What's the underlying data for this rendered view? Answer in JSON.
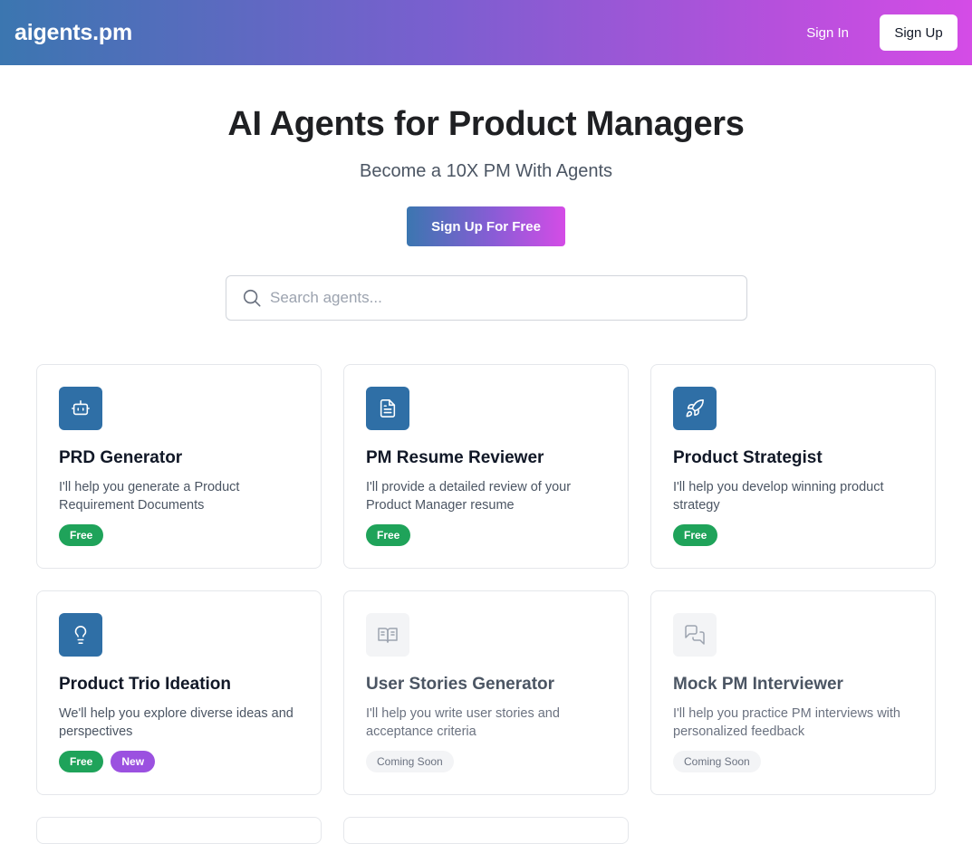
{
  "nav": {
    "logo": "aigents.pm",
    "sign_in": "Sign In",
    "sign_up": "Sign Up"
  },
  "hero": {
    "title": "AI Agents for Product Managers",
    "subtitle": "Become a 10X PM With Agents",
    "cta": "Sign Up For Free"
  },
  "search": {
    "placeholder": "Search agents...",
    "icon": "search-icon"
  },
  "colors": {
    "brand_gradient_start": "#3b76b0",
    "brand_gradient_end": "#d44ce6",
    "icon_bg_active": "#2f6fa6",
    "free_badge": "#1fa35a",
    "new_badge": "#9b51e0"
  },
  "cards": [
    {
      "title": "PRD Generator",
      "description": "I'll help you generate a Product Requirement Documents",
      "icon": "robot-icon",
      "tags": [
        "Free"
      ]
    },
    {
      "title": "PM Resume Reviewer",
      "description": "I'll provide a detailed review of your Product Manager resume",
      "icon": "document-icon",
      "tags": [
        "Free"
      ]
    },
    {
      "title": "Product Strategist",
      "description": "I'll help you develop winning product strategy",
      "icon": "rocket-icon",
      "tags": [
        "Free"
      ]
    },
    {
      "title": "Product Trio Ideation",
      "description": "We'll help you explore diverse ideas and perspectives",
      "icon": "lightbulb-icon",
      "tags": [
        "Free",
        "New"
      ]
    },
    {
      "title": "User Stories Generator",
      "description": "I'll help you write user stories and acceptance criteria",
      "icon": "book-icon",
      "tags": [
        "Coming Soon"
      ]
    },
    {
      "title": "Mock PM Interviewer",
      "description": "I'll help you practice PM interviews with personalized feedback",
      "icon": "chat-icon",
      "tags": [
        "Coming Soon"
      ]
    }
  ]
}
